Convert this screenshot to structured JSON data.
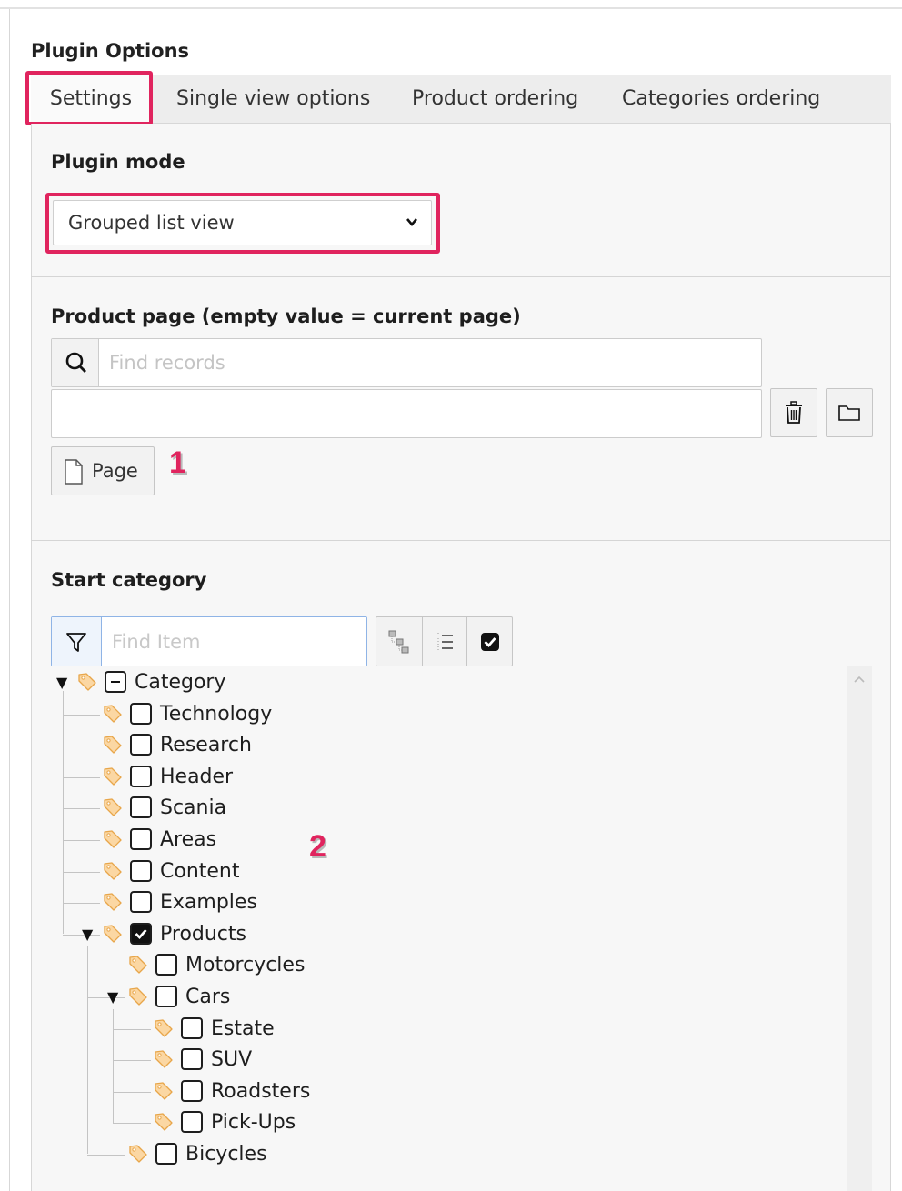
{
  "section_title": "Plugin Options",
  "tabs": [
    {
      "label": "Settings",
      "active": true
    },
    {
      "label": "Single view options",
      "active": false
    },
    {
      "label": "Product ordering",
      "active": false
    },
    {
      "label": "Categories ordering",
      "active": false
    }
  ],
  "plugin_mode": {
    "label": "Plugin mode",
    "selected": "Grouped list view"
  },
  "product_page": {
    "label": "Product page (empty value = current page)",
    "search_placeholder": "Find records",
    "value": "",
    "page_button_label": "Page"
  },
  "start_category": {
    "label": "Start category",
    "filter_placeholder": "Find Item",
    "tree": [
      {
        "label": "Category",
        "state": "indeterminate",
        "expanded": true
      },
      {
        "label": "Technology",
        "state": "unchecked"
      },
      {
        "label": "Research",
        "state": "unchecked"
      },
      {
        "label": "Header",
        "state": "unchecked"
      },
      {
        "label": "Scania",
        "state": "unchecked"
      },
      {
        "label": "Areas",
        "state": "unchecked"
      },
      {
        "label": "Content",
        "state": "unchecked"
      },
      {
        "label": "Examples",
        "state": "unchecked"
      },
      {
        "label": "Products",
        "state": "checked",
        "expanded": true
      },
      {
        "label": "Motorcycles",
        "state": "unchecked"
      },
      {
        "label": "Cars",
        "state": "unchecked",
        "expanded": true
      },
      {
        "label": "Estate",
        "state": "unchecked"
      },
      {
        "label": "SUV",
        "state": "unchecked"
      },
      {
        "label": "Roadsters",
        "state": "unchecked"
      },
      {
        "label": "Pick-Ups",
        "state": "unchecked"
      },
      {
        "label": "Bicycles",
        "state": "unchecked"
      }
    ]
  },
  "annotations": {
    "marker_1": "1",
    "marker_2": "2",
    "highlight_color": "#e0245e"
  },
  "icons": {
    "search": "magnifier-icon",
    "delete": "trash-icon",
    "browse": "folder-icon",
    "page": "document-icon",
    "filter": "funnel-icon",
    "tag": "tag-icon",
    "expand_all": "expand-all-icon",
    "collapse": "list-icon",
    "show_checked": "checkbox-icon"
  }
}
